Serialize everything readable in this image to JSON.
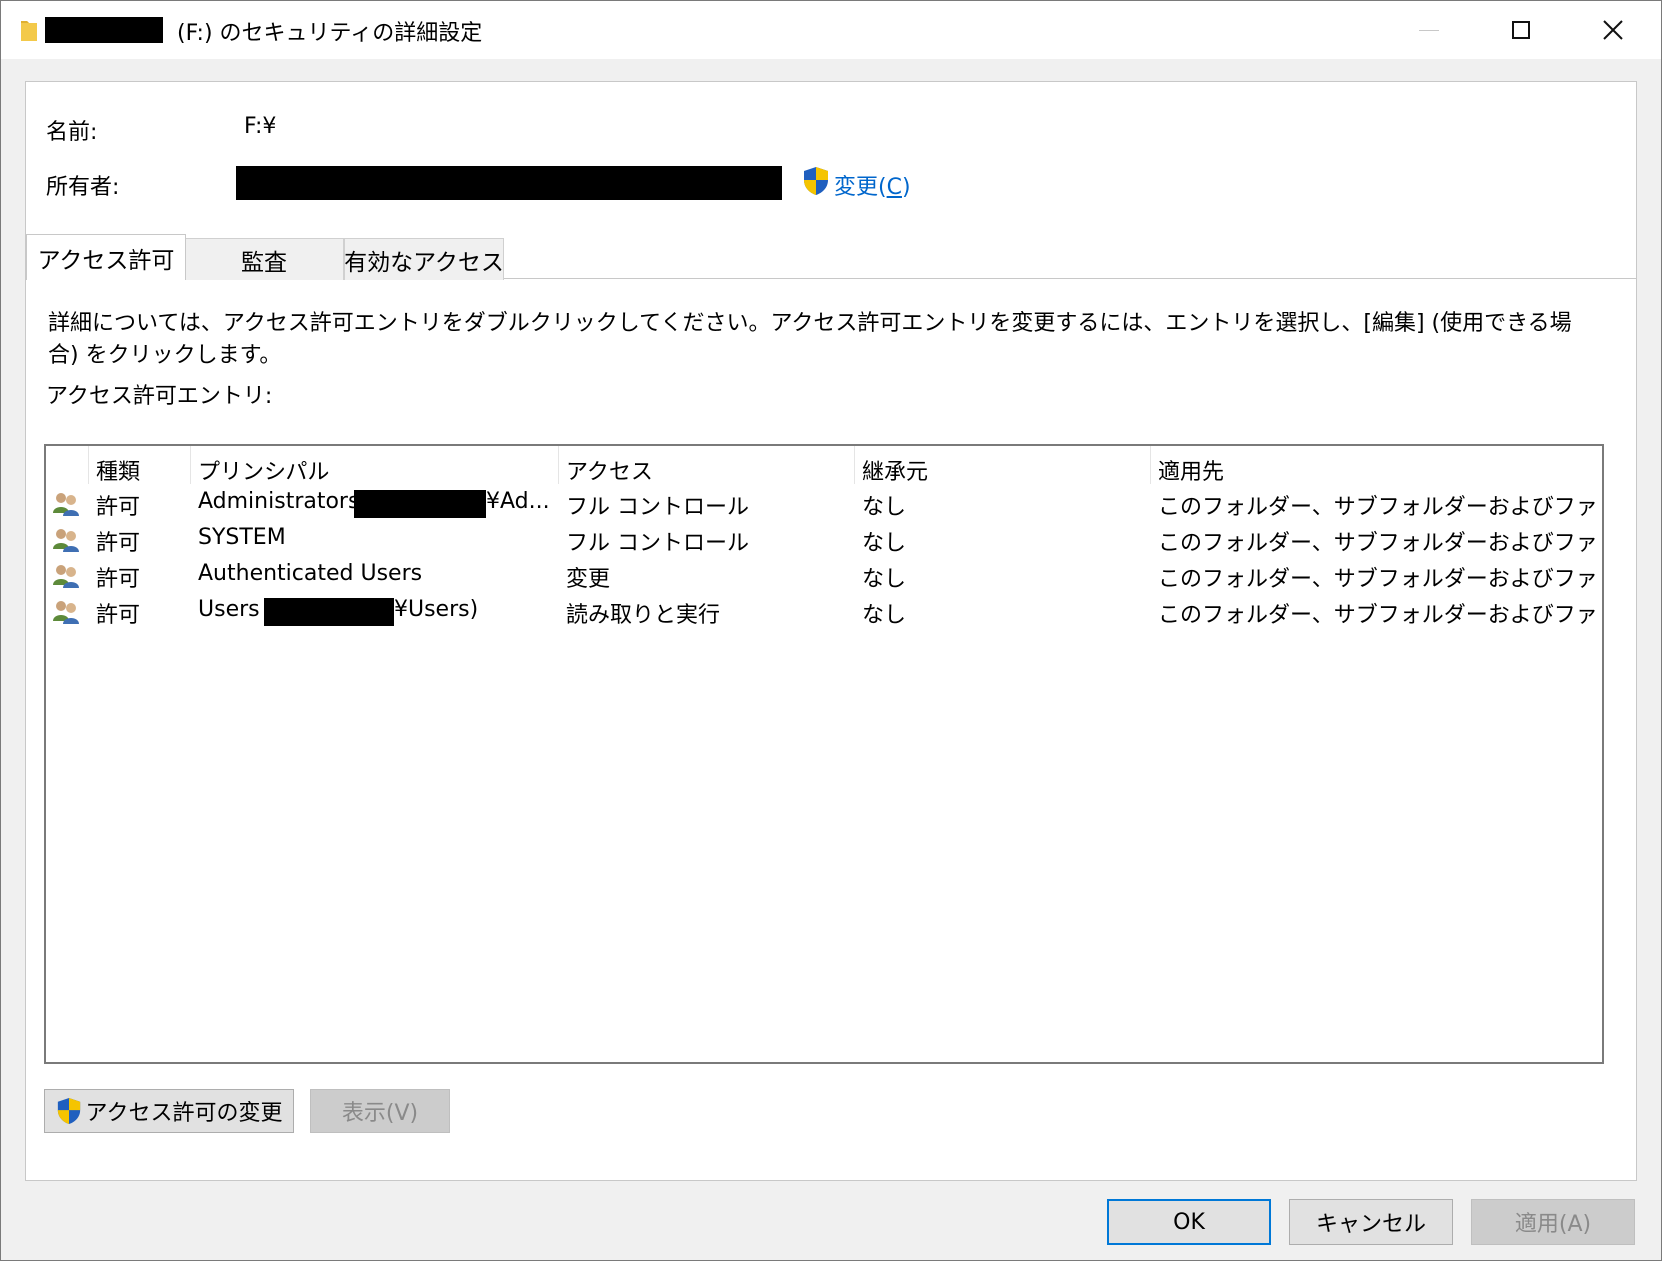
{
  "window": {
    "title": "(F:) のセキュリティの詳細設定",
    "controls": {
      "minimize": "—",
      "close": "✕"
    }
  },
  "info": {
    "name_label": "名前:",
    "name_value": "F:¥",
    "owner_label": "所有者:",
    "owner_change_link": "変更(",
    "owner_change_accel": "C",
    "owner_change_close": ")"
  },
  "tabs": [
    {
      "label": "アクセス許可",
      "active": true
    },
    {
      "label": "監査",
      "active": false
    },
    {
      "label": "有効なアクセス",
      "active": false
    }
  ],
  "description": "詳細については、アクセス許可エントリをダブルクリックしてください。アクセス許可エントリを変更するには、エントリを選択し、[編集] (使用できる場合) をクリックします。",
  "entries_label": "アクセス許可エントリ:",
  "table": {
    "columns": [
      "種類",
      "プリンシパル",
      "アクセス",
      "継承元",
      "適用先"
    ],
    "rows": [
      {
        "type": "許可",
        "principal_a": "Administrators (",
        "principal_b": "¥Ad...",
        "access": "フル コントロール",
        "inherited": "なし",
        "applies": "このフォルダー、サブフォルダーおよびファイ..."
      },
      {
        "type": "許可",
        "principal_a": "SYSTEM",
        "principal_b": "",
        "access": "フル コントロール",
        "inherited": "なし",
        "applies": "このフォルダー、サブフォルダーおよびファイ..."
      },
      {
        "type": "許可",
        "principal_a": "Authenticated Users",
        "principal_b": "",
        "access": "変更",
        "inherited": "なし",
        "applies": "このフォルダー、サブフォルダーおよびファイ..."
      },
      {
        "type": "許可",
        "principal_a": "Users (",
        "principal_b": "¥Users)",
        "access": "読み取りと実行",
        "inherited": "なし",
        "applies": "このフォルダー、サブフォルダーおよびファイ..."
      }
    ]
  },
  "buttons": {
    "change_permissions": "アクセス許可の変更",
    "view": "表示(V)",
    "ok": "OK",
    "cancel": "キャンセル",
    "apply": "適用(A)"
  },
  "colors": {
    "link": "#0066cc",
    "default_button_border": "#0078d7",
    "shield_blue": "#1f5fbf",
    "shield_yellow": "#f5c400"
  }
}
